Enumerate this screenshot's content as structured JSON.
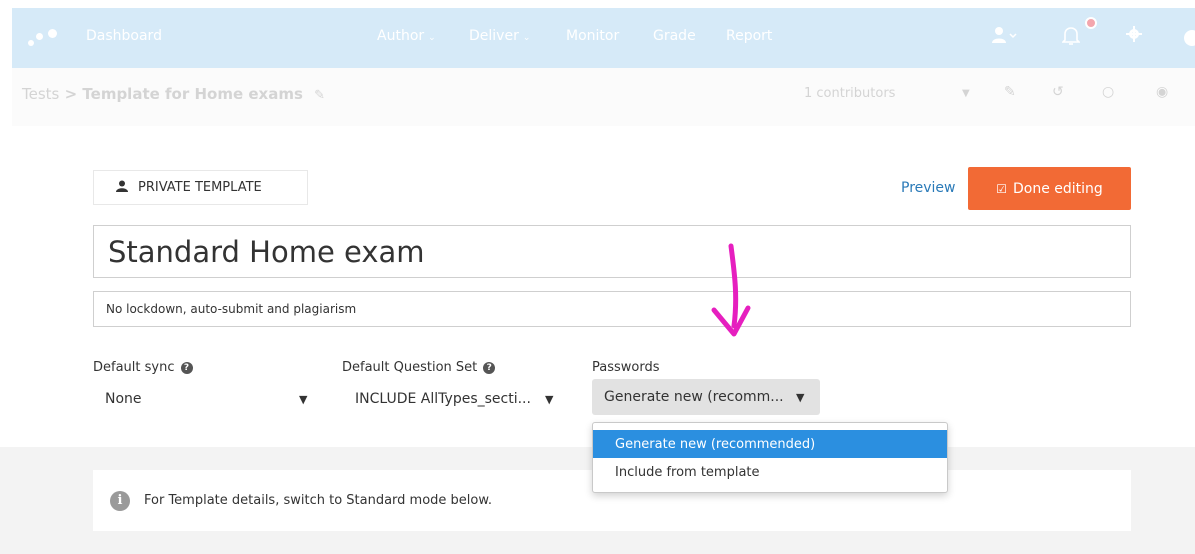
{
  "nav": {
    "dashboard": "Dashboard",
    "author": "Author",
    "deliver": "Deliver",
    "monitor": "Monitor",
    "grade": "Grade",
    "report": "Report",
    "caret": "⌄"
  },
  "breadcrumb": {
    "root": "Tests",
    "separator": ">",
    "current": "Template for Home exams",
    "contributors": "1 contributors"
  },
  "toolbar": {
    "private_label": "PRIVATE TEMPLATE",
    "preview_label": "Preview",
    "done_label": "Done editing"
  },
  "form": {
    "title_value": "Standard Home exam",
    "description_value": "No lockdown, auto-submit and plagiarism",
    "default_sync": {
      "label": "Default sync",
      "value": "None"
    },
    "default_question_set": {
      "label": "Default Question Set",
      "value": "INCLUDE AllTypes_secti..."
    },
    "passwords": {
      "label": "Passwords",
      "value": "Generate new (recomm..."
    }
  },
  "passwords_menu": {
    "options": [
      "Generate new (recommended)",
      "Include from template"
    ],
    "selected_index": 0
  },
  "info": {
    "message": "For Template details, switch to Standard mode below."
  },
  "colors": {
    "topbar": "#d6eaf8",
    "done_button": "#f26a35",
    "preview_link": "#2a7ab8",
    "menu_highlight": "#2b8fe0",
    "annotation": "#e61fbf"
  }
}
